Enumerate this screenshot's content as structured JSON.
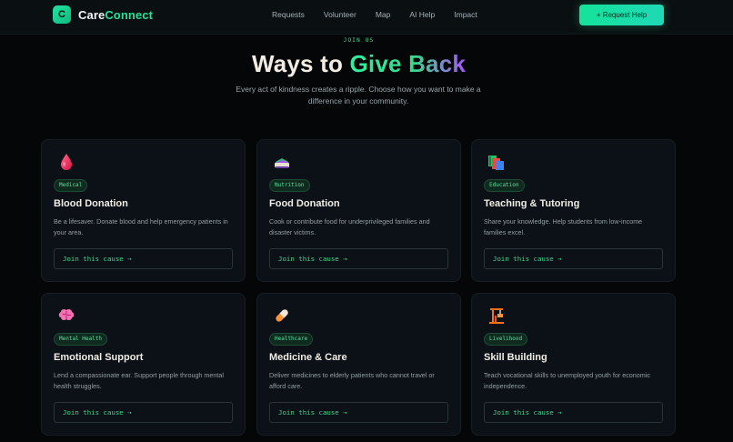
{
  "brand": {
    "mark": "C",
    "name_a": "Care",
    "name_b": "Connect"
  },
  "nav": {
    "links": [
      "Requests",
      "Volunteer",
      "Map",
      "AI Help",
      "Impact"
    ],
    "cta": "+ Request Help"
  },
  "hero": {
    "eyebrow": "JOIN US",
    "title_a": "Ways to ",
    "title_b": "Give Back",
    "subtitle": "Every act of kindness creates a ripple. Choose how you want to make a difference in your community."
  },
  "colors": {
    "accent": "#22e39c",
    "accent2": "#a855f7",
    "bg": "#040607",
    "card": "#0b1116"
  },
  "cards": [
    {
      "icon": "blood-drop-icon",
      "tag": "Medical",
      "title": "Blood Donation",
      "desc": "Be a lifesaver. Donate blood and help emergency patients in your area.",
      "cta": "Join this cause →"
    },
    {
      "icon": "food-bowl-icon",
      "tag": "Nutrition",
      "title": "Food Donation",
      "desc": "Cook or contribute food for underprivileged families and disaster victims.",
      "cta": "Join this cause →"
    },
    {
      "icon": "books-icon",
      "tag": "Education",
      "title": "Teaching & Tutoring",
      "desc": "Share your knowledge. Help students from low-income families excel.",
      "cta": "Join this cause →"
    },
    {
      "icon": "brain-icon",
      "tag": "Mental Health",
      "title": "Emotional Support",
      "desc": "Lend a compassionate ear. Support people through mental health struggles.",
      "cta": "Join this cause →"
    },
    {
      "icon": "pill-icon",
      "tag": "Healthcare",
      "title": "Medicine & Care",
      "desc": "Deliver medicines to elderly patients who cannot travel or afford care.",
      "cta": "Join this cause →"
    },
    {
      "icon": "workshop-icon",
      "tag": "Livelihood",
      "title": "Skill Building",
      "desc": "Teach vocational skills to unemployed youth for economic independence.",
      "cta": "Join this cause →"
    }
  ]
}
